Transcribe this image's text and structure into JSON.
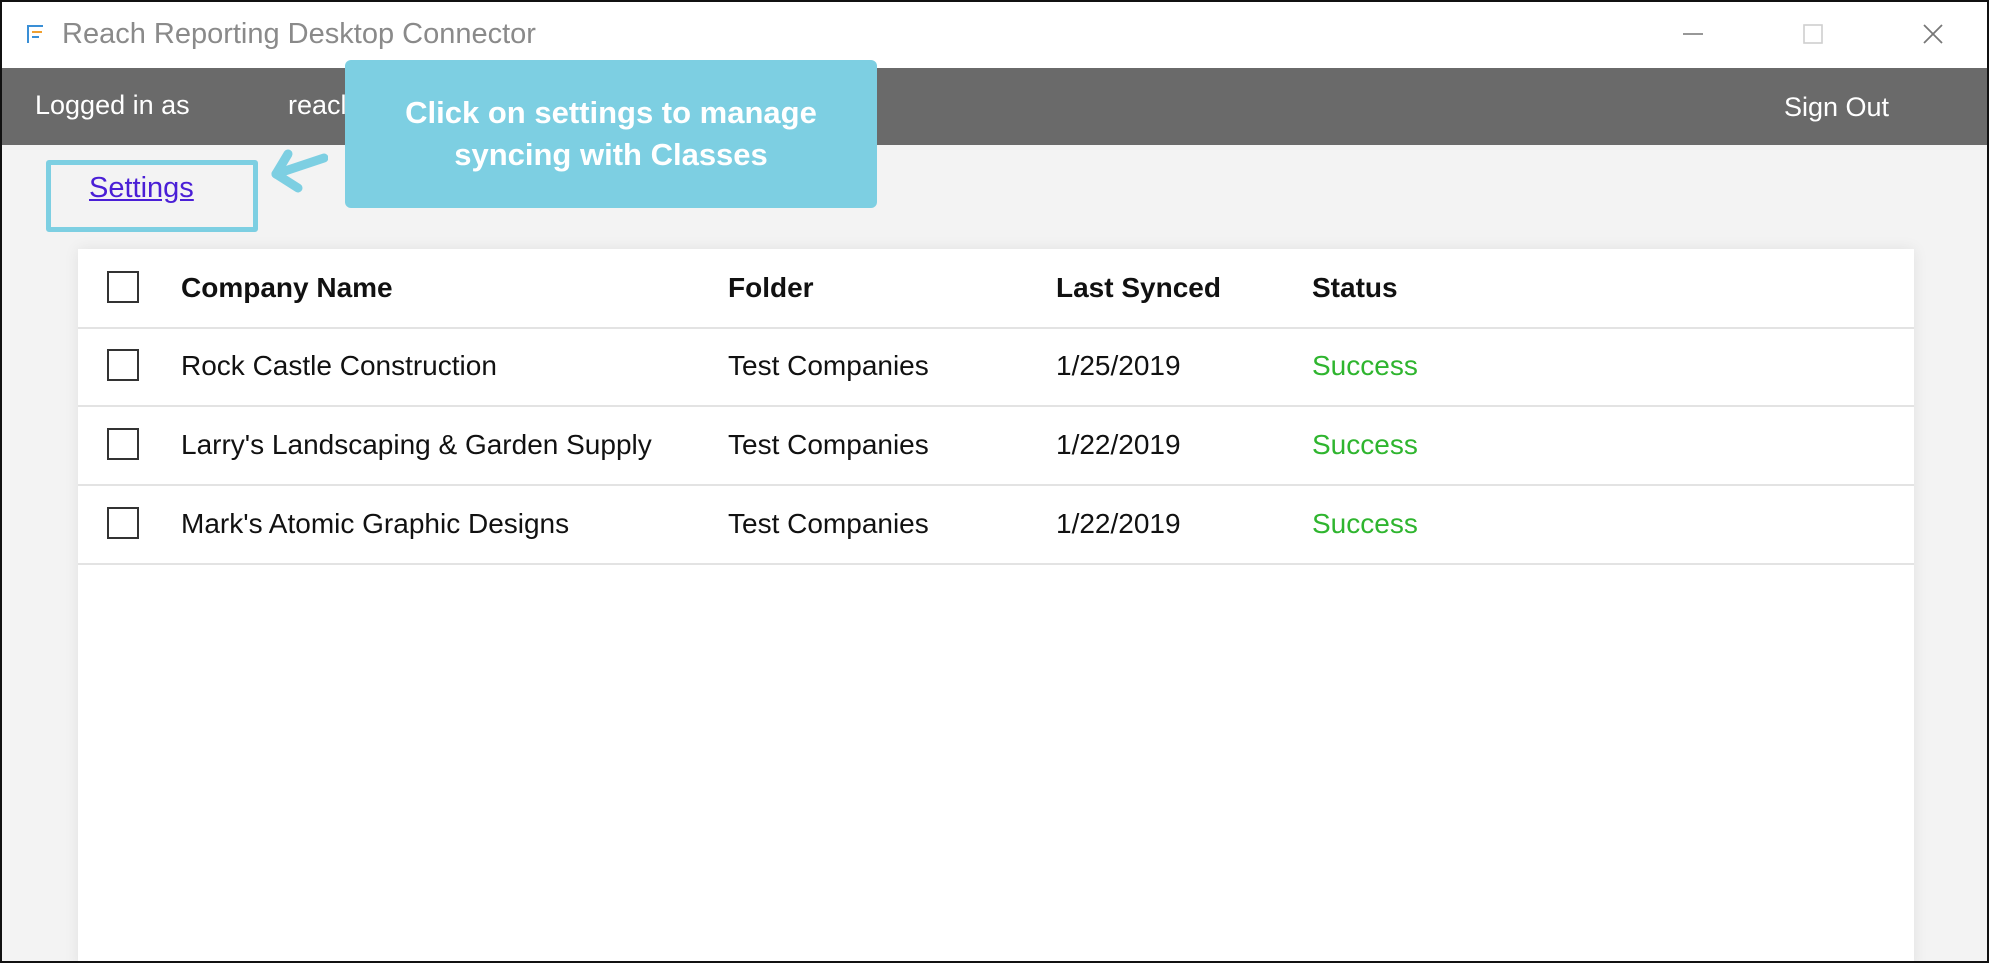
{
  "window": {
    "title": "Reach Reporting Desktop Connector",
    "icon": "reach-app-icon",
    "controls": [
      "minimize-icon",
      "maximize-icon",
      "close-icon"
    ]
  },
  "header": {
    "logged_in_label": "Logged in as",
    "username": "reacl",
    "sign_out_label": "Sign Out"
  },
  "callout": {
    "line1": "Click on settings to manage",
    "line2": "syncing with Classes",
    "color": "#7dcfe2"
  },
  "settings_link": "Settings",
  "table": {
    "columns": [
      "Company Name",
      "Folder",
      "Last Synced",
      "Status"
    ],
    "rows": [
      {
        "company": "Rock Castle Construction",
        "folder": "Test Companies",
        "last_synced": "1/25/2019",
        "status": "Success"
      },
      {
        "company": "Larry's Landscaping & Garden Supply",
        "folder": "Test Companies",
        "last_synced": "1/22/2019",
        "status": "Success"
      },
      {
        "company": "Mark's Atomic Graphic Designs",
        "folder": "Test Companies",
        "last_synced": "1/22/2019",
        "status": "Success"
      }
    ]
  },
  "colors": {
    "header_bg": "#6a6a6a",
    "status_success": "#2fb52f",
    "link": "#4a1fd6"
  }
}
